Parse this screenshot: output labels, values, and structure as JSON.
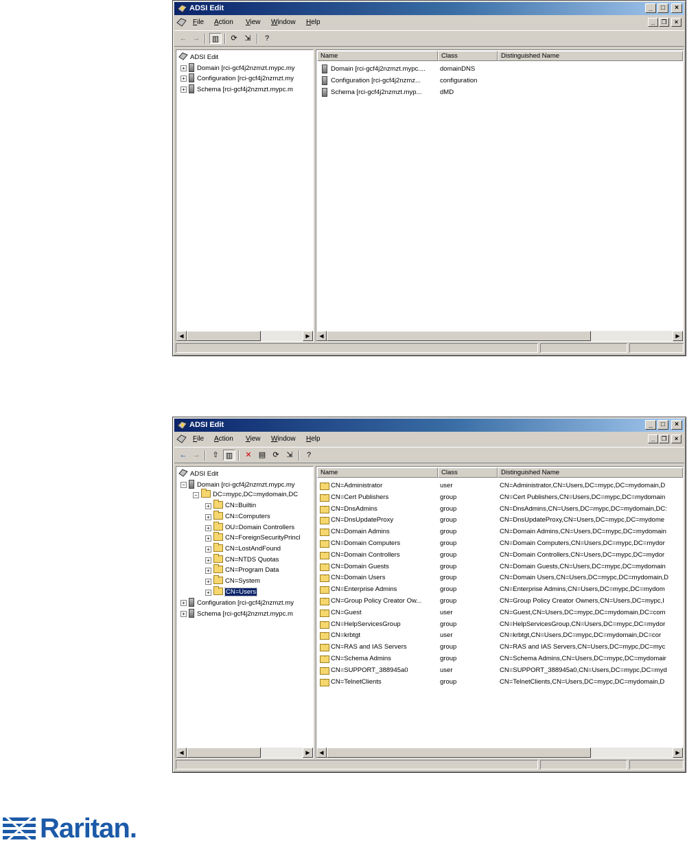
{
  "window_title": "ADSI Edit",
  "menu": [
    "File",
    "Action",
    "View",
    "Window",
    "Help"
  ],
  "colors": {
    "title_start": "#0a246a",
    "title_end": "#a6caf0",
    "chrome": "#d4d0c8",
    "selection": "#0a246a",
    "brand": "#1c5aa8"
  },
  "columns": [
    "Name",
    "Class",
    "Distinguished Name"
  ],
  "top_window": {
    "tree": [
      {
        "label": "ADSI Edit",
        "icon": "adsi-icon"
      },
      {
        "label": "Domain [rci-gcf4j2nzmzt.mypc.my",
        "icon": "server-icon",
        "expander": "+"
      },
      {
        "label": "Configuration [rci-gcf4j2nzmzt.my",
        "icon": "server-icon",
        "expander": "+"
      },
      {
        "label": "Schema [rci-gcf4j2nzmzt.mypc.m",
        "icon": "server-icon",
        "expander": "+"
      }
    ],
    "rows": [
      {
        "name": "Domain [rci-gcf4j2nzmzt.mypc....",
        "class": "domainDNS",
        "dn": ""
      },
      {
        "name": "Configuration [rci-gcf4j2nzmz...",
        "class": "configuration",
        "dn": ""
      },
      {
        "name": "Schema [rci-gcf4j2nzmzt.myp...",
        "class": "dMD",
        "dn": ""
      }
    ]
  },
  "bottom_window": {
    "tree": [
      {
        "label": "ADSI Edit",
        "icon": "adsi-icon"
      },
      {
        "label": "Domain [rci-gcf4j2nzmzt.mypc.my",
        "icon": "server-icon",
        "expander": "-"
      },
      {
        "label": "DC=mypc,DC=mydomain,DC",
        "icon": "folder-icon",
        "expander": "-"
      },
      {
        "label": "CN=Builtin",
        "icon": "folder-icon",
        "expander": "+"
      },
      {
        "label": "CN=Computers",
        "icon": "folder-icon",
        "expander": "+"
      },
      {
        "label": "OU=Domain Controllers",
        "icon": "folder-icon",
        "expander": "+"
      },
      {
        "label": "CN=ForeignSecurityPrincl",
        "icon": "folder-icon",
        "expander": "+"
      },
      {
        "label": "CN=LostAndFound",
        "icon": "folder-icon",
        "expander": "+"
      },
      {
        "label": "CN=NTDS Quotas",
        "icon": "folder-icon",
        "expander": "+"
      },
      {
        "label": "CN=Program Data",
        "icon": "folder-icon",
        "expander": "+"
      },
      {
        "label": "CN=System",
        "icon": "folder-icon",
        "expander": "+"
      },
      {
        "label": "CN=Users",
        "icon": "folder-icon",
        "expander": "+",
        "selected": true
      },
      {
        "label": "Configuration [rci-gcf4j2nzmzt.my",
        "icon": "server-icon",
        "expander": "+"
      },
      {
        "label": "Schema [rci-gcf4j2nzmzt.mypc.m",
        "icon": "server-icon",
        "expander": "+"
      }
    ],
    "rows": [
      {
        "name": "CN=Administrator",
        "class": "user",
        "dn": "CN=Administrator,CN=Users,DC=mypc,DC=mydomain,D"
      },
      {
        "name": "CN=Cert Publishers",
        "class": "group",
        "dn": "CN=Cert Publishers,CN=Users,DC=mypc,DC=mydomain"
      },
      {
        "name": "CN=DnsAdmins",
        "class": "group",
        "dn": "CN=DnsAdmins,CN=Users,DC=mypc,DC=mydomain,DC:"
      },
      {
        "name": "CN=DnsUpdateProxy",
        "class": "group",
        "dn": "CN=DnsUpdateProxy,CN=Users,DC=mypc,DC=mydome"
      },
      {
        "name": "CN=Domain Admins",
        "class": "group",
        "dn": "CN=Domain Admins,CN=Users,DC=mypc,DC=mydomain"
      },
      {
        "name": "CN=Domain Computers",
        "class": "group",
        "dn": "CN=Domain Computers,CN=Users,DC=mypc,DC=mydor"
      },
      {
        "name": "CN=Domain Controllers",
        "class": "group",
        "dn": "CN=Domain Controllers,CN=Users,DC=mypc,DC=mydor"
      },
      {
        "name": "CN=Domain Guests",
        "class": "group",
        "dn": "CN=Domain Guests,CN=Users,DC=mypc,DC=mydomain"
      },
      {
        "name": "CN=Domain Users",
        "class": "group",
        "dn": "CN=Domain Users,CN=Users,DC=mypc,DC=mydomain,D"
      },
      {
        "name": "CN=Enterprise Admins",
        "class": "group",
        "dn": "CN=Enterprise Admins,CN=Users,DC=mypc,DC=mydom"
      },
      {
        "name": "CN=Group Policy Creator Ow...",
        "class": "group",
        "dn": "CN=Group Policy Creator Owners,CN=Users,DC=mypc,I"
      },
      {
        "name": "CN=Guest",
        "class": "user",
        "dn": "CN=Guest,CN=Users,DC=mypc,DC=mydomain,DC=com"
      },
      {
        "name": "CN=HelpServicesGroup",
        "class": "group",
        "dn": "CN=HelpServicesGroup,CN=Users,DC=mypc,DC=mydor"
      },
      {
        "name": "CN=krbtgt",
        "class": "user",
        "dn": "CN=krbtgt,CN=Users,DC=mypc,DC=mydomain,DC=cor"
      },
      {
        "name": "CN=RAS and IAS Servers",
        "class": "group",
        "dn": "CN=RAS and IAS Servers,CN=Users,DC=mypc,DC=myc"
      },
      {
        "name": "CN=Schema Admins",
        "class": "group",
        "dn": "CN=Schema Admins,CN=Users,DC=mypc,DC=mydomair"
      },
      {
        "name": "CN=SUPPORT_388945a0",
        "class": "user",
        "dn": "CN=SUPPORT_388945a0,CN=Users,DC=mypc,DC=myd"
      },
      {
        "name": "CN=TelnetClients",
        "class": "group",
        "dn": "CN=TelnetClients,CN=Users,DC=mypc,DC=mydomain,D"
      }
    ]
  },
  "logo_text": "Raritan."
}
